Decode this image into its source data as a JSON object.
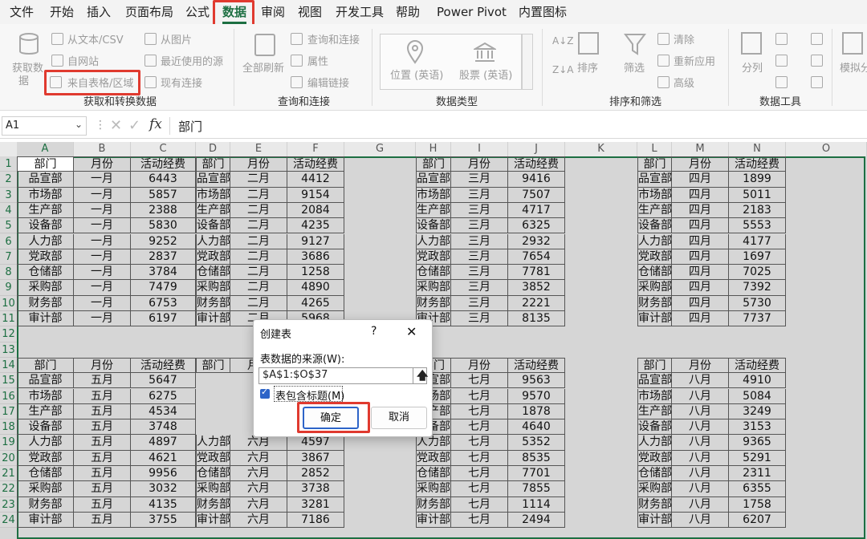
{
  "menu": {
    "items": [
      "文件",
      "开始",
      "插入",
      "页面布局",
      "公式",
      "数据",
      "审阅",
      "视图",
      "开发工具",
      "帮助",
      "Power Pivot",
      "内置图标"
    ],
    "active": "数据"
  },
  "ribbon": {
    "get_data": [
      "获取数",
      "据"
    ],
    "from_text_csv": "从文本/CSV",
    "from_web": "自网站",
    "from_table_range": "来自表格/区域",
    "from_picture": "从图片",
    "recent_sources": "最近使用的源",
    "existing_connections": "现有连接",
    "group_get_transform": "获取和转换数据",
    "refresh_all": "全部刷新",
    "queries_connections": "查询和连接",
    "properties": "属性",
    "edit_links": "编辑链接",
    "group_queries": "查询和连接",
    "location": "位置 (英语)",
    "stocks": "股票 (英语)",
    "group_data_types": "数据类型",
    "sort": "排序",
    "filter": "筛选",
    "clear": "清除",
    "reapply": "重新应用",
    "advanced": "高级",
    "group_sort_filter": "排序和筛选",
    "split": "分列",
    "group_data_tools": "数据工具",
    "what_if": "模拟分"
  },
  "formula_bar": {
    "name_box": "A1",
    "fx": "fx",
    "content": "部门"
  },
  "columns": [
    "A",
    "B",
    "C",
    "D",
    "E",
    "F",
    "G",
    "H",
    "I",
    "J",
    "K",
    "L",
    "M",
    "N",
    "O"
  ],
  "rows": [
    "1",
    "2",
    "3",
    "4",
    "5",
    "6",
    "7",
    "8",
    "9",
    "10",
    "11",
    "12",
    "13",
    "14",
    "15",
    "16",
    "17",
    "18",
    "19",
    "20",
    "21",
    "22",
    "23",
    "24"
  ],
  "tables": {
    "header": [
      "部门",
      "月份",
      "活动经费"
    ],
    "departments": [
      "品宣部",
      "市场部",
      "生产部",
      "设备部",
      "人力部",
      "党政部",
      "仓储部",
      "采购部",
      "财务部",
      "审计部"
    ],
    "top": [
      {
        "month": "一月",
        "values": [
          "6443",
          "5857",
          "2388",
          "5830",
          "9252",
          "2837",
          "3784",
          "7479",
          "6753",
          "6197"
        ]
      },
      {
        "month": "二月",
        "values": [
          "4412",
          "9154",
          "2084",
          "4235",
          "9127",
          "3686",
          "1258",
          "4890",
          "4265",
          "5968"
        ]
      },
      {
        "month": "三月",
        "values": [
          "9416",
          "7507",
          "4717",
          "6325",
          "2932",
          "7654",
          "7781",
          "3852",
          "2221",
          "8135"
        ]
      },
      {
        "month": "四月",
        "values": [
          "1899",
          "5011",
          "2183",
          "5553",
          "4177",
          "1697",
          "7025",
          "7392",
          "5730",
          "7737"
        ]
      }
    ],
    "bottom": [
      {
        "month": "五月",
        "values": [
          "5647",
          "6275",
          "4534",
          "3748",
          "4897",
          "4621",
          "9956",
          "3032",
          "4135",
          "3755"
        ]
      },
      {
        "month": "六月",
        "values": [
          "",
          "",
          "",
          "",
          "4597",
          "3867",
          "2852",
          "3738",
          "3281",
          "7186"
        ]
      },
      {
        "month": "七月",
        "values": [
          "9563",
          "9570",
          "1878",
          "4640",
          "5352",
          "8535",
          "7701",
          "7855",
          "1114",
          "2494"
        ]
      },
      {
        "month": "八月",
        "values": [
          "4910",
          "5084",
          "3249",
          "3153",
          "9365",
          "5291",
          "2311",
          "6355",
          "1758",
          "6207"
        ]
      }
    ]
  },
  "dialog": {
    "title": "创建表",
    "help": "?",
    "close": "✕",
    "source_label": "表数据的来源(W):",
    "source_value": "$A$1:$O$37",
    "headers_checkbox": "表包含标题(M)",
    "ok": "确定",
    "cancel": "取消"
  },
  "colors": {
    "accent": "#1d6f42",
    "highlight": "#e03a2f",
    "selection": "#d5d5d5"
  }
}
